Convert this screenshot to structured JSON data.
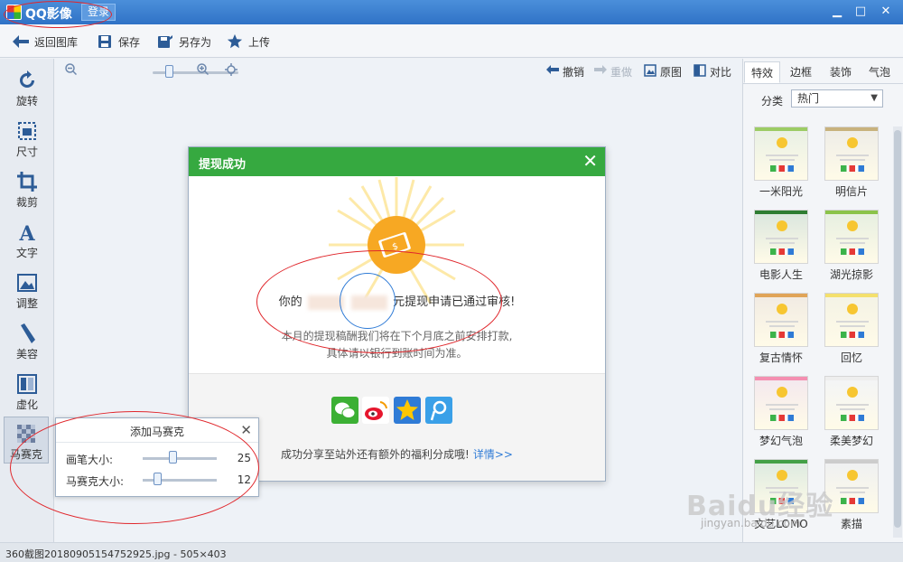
{
  "window": {
    "title": "QQ影像",
    "login": "登录",
    "minimize": "▁",
    "maximize": "□",
    "close": "✕"
  },
  "toolbar": {
    "back": "返回图库",
    "save": "保存",
    "save_as": "另存为",
    "upload": "上传"
  },
  "left_tools": [
    {
      "label": "旋转",
      "icon": "rotate-icon"
    },
    {
      "label": "尺寸",
      "icon": "size-icon"
    },
    {
      "label": "裁剪",
      "icon": "crop-icon"
    },
    {
      "label": "文字",
      "icon": "text-icon"
    },
    {
      "label": "调整",
      "icon": "adjust-icon"
    },
    {
      "label": "美容",
      "icon": "beauty-icon"
    },
    {
      "label": "虚化",
      "icon": "blur-icon"
    },
    {
      "label": "马赛克",
      "icon": "mosaic-icon"
    }
  ],
  "canvas_controls": {
    "undo": "撤销",
    "redo": "重做",
    "original": "原图",
    "compare": "对比"
  },
  "dialog": {
    "title": "提现成功",
    "close": "✕",
    "message_prefix": "你的",
    "message_suffix": "元提现申请已通过审核!",
    "note_line1": "本月的提现稿酬我们将在下个月底之前安排打款,",
    "note_line2": "具体请以银行到账时间为准。",
    "share_text": "成功分享至站外还有额外的福利分成哦!",
    "share_link": "详情>>"
  },
  "mosaic_panel": {
    "title": "添加马赛克",
    "close": "✕",
    "brush_label": "画笔大小:",
    "brush_value": "25",
    "brush_fraction": 0.4,
    "mosaic_label": "马赛克大小:",
    "mosaic_value": "12",
    "mosaic_fraction": 0.2
  },
  "right_panel": {
    "tabs": [
      "特效",
      "边框",
      "装饰",
      "气泡"
    ],
    "category_label": "分类",
    "category_value": "热门",
    "templates": [
      {
        "name": "一米阳光",
        "color": "#9ccc65"
      },
      {
        "name": "明信片",
        "color": "#c8b27d"
      },
      {
        "name": "电影人生",
        "color": "#2e7d32"
      },
      {
        "name": "湖光掠影",
        "color": "#8bc34a"
      },
      {
        "name": "复古情怀",
        "color": "#e0a458"
      },
      {
        "name": "回忆",
        "color": "#f4e06d"
      },
      {
        "name": "梦幻气泡",
        "color": "#f48fb1"
      },
      {
        "name": "柔美梦幻",
        "color": "#eeeeee"
      },
      {
        "name": "文艺LOMO",
        "color": "#43a047"
      },
      {
        "name": "素描",
        "color": "#cccccc"
      }
    ]
  },
  "statusbar": {
    "text": "360截图20180905154752925.jpg - 505×403"
  },
  "watermark": {
    "text": "Baidu经验",
    "sub": "jingyan.baidu.com"
  },
  "colors": {
    "accent_blue": "#2f72c6",
    "dialog_green": "#36a940",
    "annotation_red": "#e0262b",
    "link_blue": "#2f7bd6"
  }
}
